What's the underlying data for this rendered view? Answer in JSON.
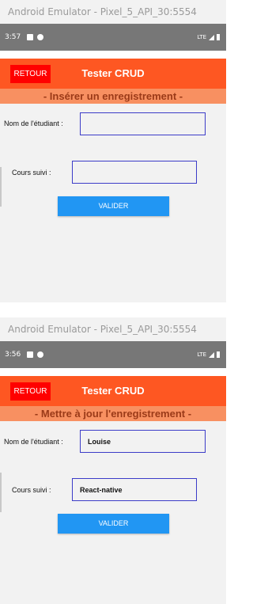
{
  "screens": [
    {
      "emulator_title": "Android Emulator - Pixel_5_API_30:5554",
      "status_time": "3:57",
      "network": "LTE",
      "back_label": "RETOUR",
      "app_title": "Tester CRUD",
      "subtitle": "- Insérer un enregistrement -",
      "name_label": "Nom de l'étudiant :",
      "name_value": "",
      "course_label": "Cours suivi :",
      "course_value": "",
      "submit_label": "VALIDER"
    },
    {
      "emulator_title": "Android Emulator - Pixel_5_API_30:5554",
      "status_time": "3:56",
      "network": "LTE",
      "back_label": "RETOUR",
      "app_title": "Tester CRUD",
      "subtitle": "- Mettre à jour l'enregistrement -",
      "name_label": "Nom de l'étudiant :",
      "name_value": "Louise",
      "course_label": "Cours suivi :",
      "course_value": "React-native",
      "submit_label": "VALIDER"
    }
  ],
  "colors": {
    "app_bar": "#fe5722",
    "back_button": "#ff0000",
    "subtitle_band": "#f89061",
    "submit_button": "#2196f3",
    "field_border": "#3c3cc8"
  }
}
